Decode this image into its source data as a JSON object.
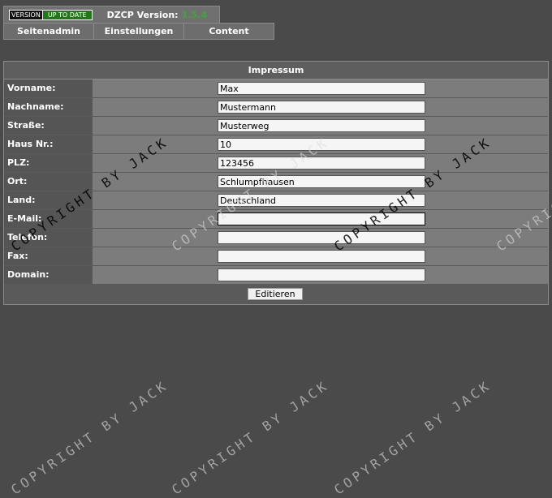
{
  "header": {
    "badge_left": "VERSION",
    "badge_right": "UP TO DATE",
    "version_label": "DZCP Version:",
    "version_value": "1.5.4"
  },
  "menu": {
    "items": [
      "Seitenadmin",
      "Einstellungen",
      "Content"
    ]
  },
  "form": {
    "title": "Impressum",
    "fields": [
      {
        "label": "Vorname:",
        "value": "Max"
      },
      {
        "label": "Nachname:",
        "value": "Mustermann"
      },
      {
        "label": "Straße:",
        "value": "Musterweg"
      },
      {
        "label": "Haus Nr.:",
        "value": "10"
      },
      {
        "label": "PLZ:",
        "value": "123456"
      },
      {
        "label": "Ort:",
        "value": "Schlumpfhausen"
      },
      {
        "label": "Land:",
        "value": "Deutschland"
      },
      {
        "label": "E-Mail:",
        "value": ""
      },
      {
        "label": "Telefon:",
        "value": ""
      },
      {
        "label": "Fax:",
        "value": ""
      },
      {
        "label": "Domain:",
        "value": ""
      }
    ],
    "submit_label": "Editieren"
  },
  "watermark": {
    "text": "COPYRIGHT BY JACK"
  },
  "colors": {
    "version_green": "#3ba832",
    "badge_green": "#1f7a16"
  }
}
